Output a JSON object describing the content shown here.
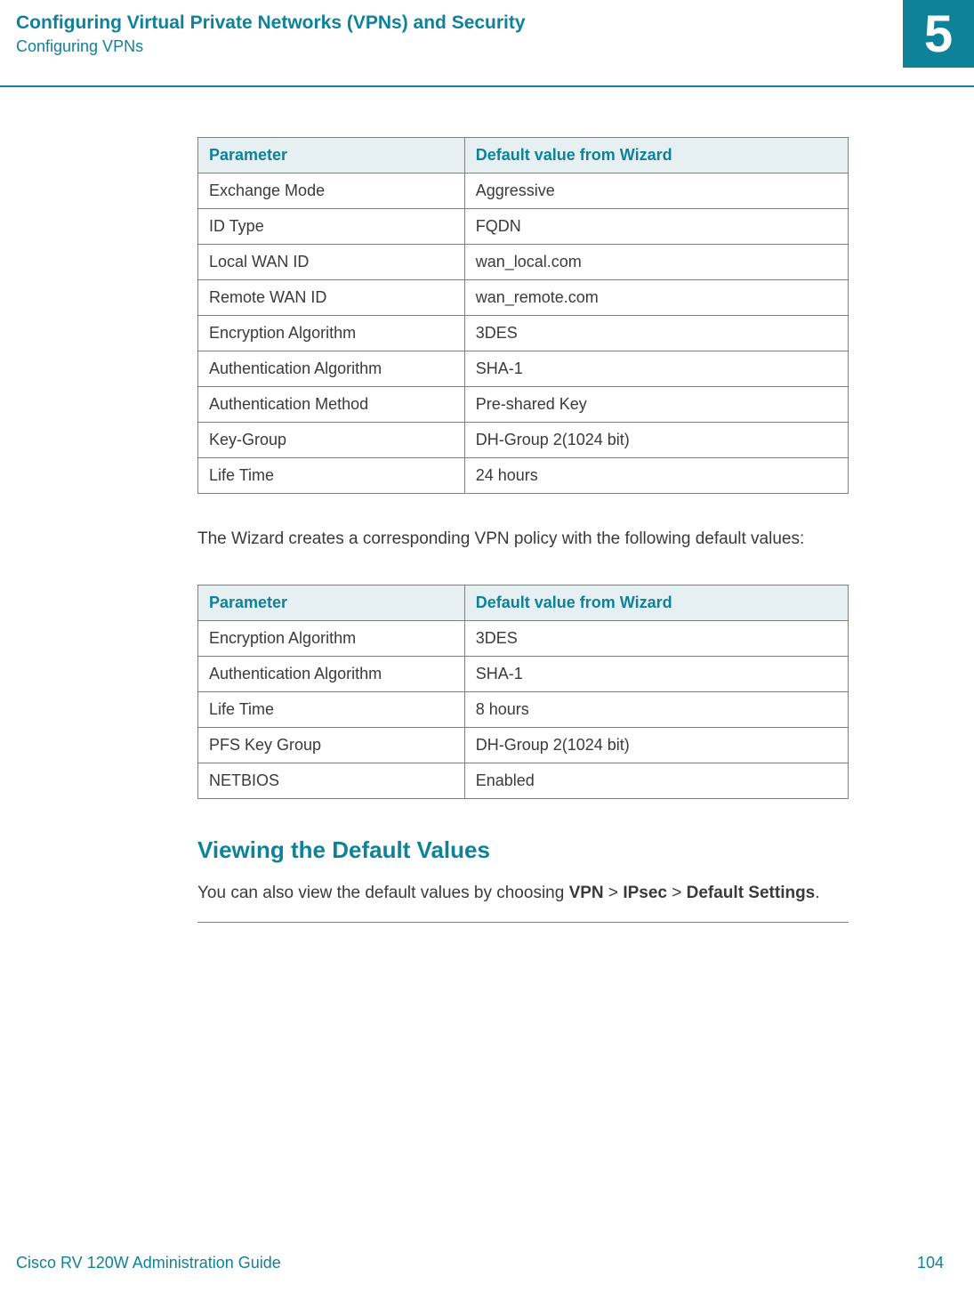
{
  "header": {
    "chapter_title": "Configuring Virtual Private Networks (VPNs) and Security",
    "section_title": "Configuring VPNs",
    "chapter_number": "5"
  },
  "table1": {
    "col_param": "Parameter",
    "col_value": "Default value from Wizard",
    "rows": [
      {
        "param": "Exchange Mode",
        "value": "Aggressive"
      },
      {
        "param": "ID Type",
        "value": "FQDN"
      },
      {
        "param": "Local WAN ID",
        "value": "wan_local.com"
      },
      {
        "param": "Remote WAN ID",
        "value": "wan_remote.com"
      },
      {
        "param": "Encryption Algorithm",
        "value": "3DES"
      },
      {
        "param": "Authentication Algorithm",
        "value": "SHA-1"
      },
      {
        "param": "Authentication Method",
        "value": "Pre-shared Key"
      },
      {
        "param": "Key-Group",
        "value": "DH-Group 2(1024 bit)"
      },
      {
        "param": "Life Time",
        "value": "24 hours"
      }
    ]
  },
  "paragraph1": "The Wizard creates a corresponding VPN policy with the following default values:",
  "table2": {
    "col_param": "Parameter",
    "col_value": "Default value from Wizard",
    "rows": [
      {
        "param": "Encryption Algorithm",
        "value": "3DES"
      },
      {
        "param": "Authentication Algorithm",
        "value": "SHA-1"
      },
      {
        "param": "Life Time",
        "value": "8 hours"
      },
      {
        "param": "PFS Key Group",
        "value": "DH-Group 2(1024 bit)"
      },
      {
        "param": "NETBIOS",
        "value": "Enabled"
      }
    ]
  },
  "heading2": "Viewing the Default Values",
  "nav": {
    "prefix": "You can also view the default values by choosing ",
    "p1": "VPN",
    "sep": " > ",
    "p2": "IPsec",
    "p3": "Default Settings",
    "suffix": "."
  },
  "footer": {
    "guide": "Cisco RV 120W Administration Guide",
    "page": "104"
  }
}
